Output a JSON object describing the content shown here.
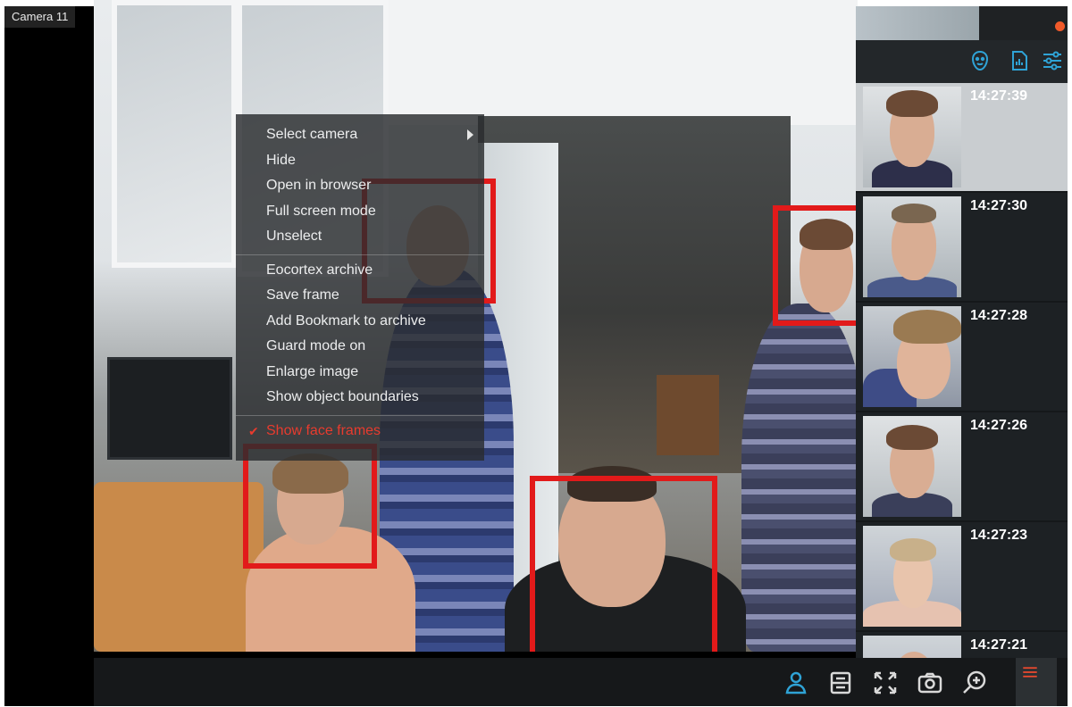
{
  "camera": {
    "title": "Camera 11"
  },
  "context_menu": {
    "groups": [
      [
        {
          "label": "Select camera",
          "has_submenu": true
        },
        {
          "label": "Hide"
        },
        {
          "label": "Open in browser"
        },
        {
          "label": "Full screen mode"
        },
        {
          "label": "Unselect"
        }
      ],
      [
        {
          "label": "Eocortex archive"
        },
        {
          "label": "Save frame"
        },
        {
          "label": "Add Bookmark to archive"
        },
        {
          "label": "Guard mode on"
        },
        {
          "label": "Enlarge image"
        },
        {
          "label": "Show object boundaries"
        }
      ],
      [
        {
          "label": "Show face frames",
          "checked": true
        }
      ]
    ],
    "check_symbol": "✔"
  },
  "right_panel": {
    "toolbar_icons": [
      "face-recognition-icon",
      "report-icon",
      "filter-settings-icon"
    ],
    "events": [
      {
        "time": "14:27:39",
        "selected": true
      },
      {
        "time": "14:27:30",
        "selected": false
      },
      {
        "time": "14:27:28",
        "selected": false
      },
      {
        "time": "14:27:26",
        "selected": false
      },
      {
        "time": "14:27:23",
        "selected": false
      },
      {
        "time": "14:27:21",
        "selected": false
      }
    ]
  },
  "bottom_toolbar": {
    "icons": [
      "person-icon",
      "layout-icon",
      "fullscreen-icon",
      "camera-snapshot-icon",
      "zoom-in-icon",
      "hamburger-menu-icon"
    ]
  },
  "colors": {
    "face_frame": "#e21a1a",
    "accent": "#2fa3d6",
    "checked_item": "#e83b2e",
    "recording_dot": "#f15a2a"
  }
}
